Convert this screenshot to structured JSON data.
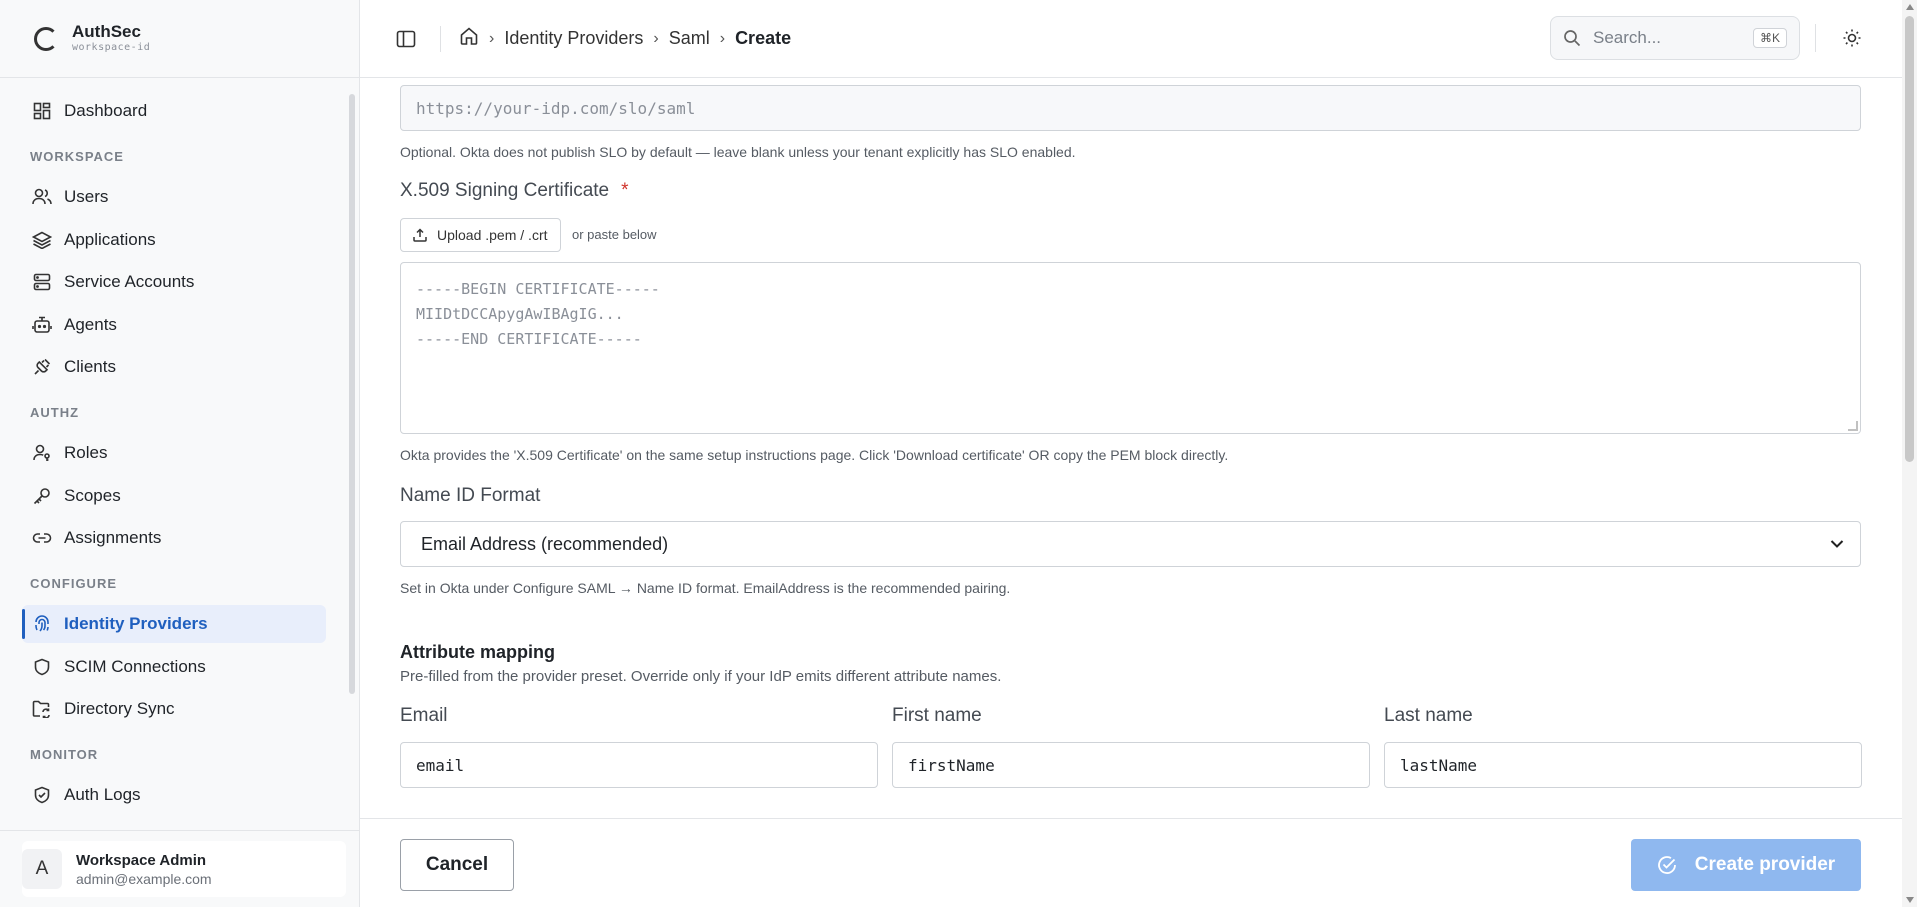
{
  "brand": {
    "name": "AuthSec",
    "workspace": "workspace-id"
  },
  "sidebar": {
    "items": [
      {
        "label": "Dashboard",
        "icon": "dashboard-icon"
      },
      {
        "section": "WORKSPACE"
      },
      {
        "label": "Users",
        "icon": "users-icon"
      },
      {
        "label": "Applications",
        "icon": "layers-icon"
      },
      {
        "label": "Service Accounts",
        "icon": "server-icon"
      },
      {
        "label": "Agents",
        "icon": "bot-icon"
      },
      {
        "label": "Clients",
        "icon": "plug-icon"
      },
      {
        "section": "AUTHZ"
      },
      {
        "label": "Roles",
        "icon": "user-key-icon"
      },
      {
        "label": "Scopes",
        "icon": "key-icon"
      },
      {
        "label": "Assignments",
        "icon": "link-icon"
      },
      {
        "section": "CONFIGURE"
      },
      {
        "label": "Identity Providers",
        "icon": "fingerprint-icon",
        "active": true
      },
      {
        "label": "SCIM Connections",
        "icon": "shield-icon"
      },
      {
        "label": "Directory Sync",
        "icon": "folder-sync-icon"
      },
      {
        "section": "MONITOR"
      },
      {
        "label": "Auth Logs",
        "icon": "shield-check-icon"
      }
    ]
  },
  "user": {
    "initial": "A",
    "name": "Workspace Admin",
    "email": "admin@example.com"
  },
  "header": {
    "breadcrumb": [
      "Identity Providers",
      "Saml",
      "Create"
    ],
    "search_placeholder": "Search...",
    "search_shortcut": "⌘K"
  },
  "form": {
    "slo_url": {
      "placeholder": "https://your-idp.com/slo/saml",
      "hint": "Optional. Okta does not publish SLO by default — leave blank unless your tenant explicitly has SLO enabled."
    },
    "certificate": {
      "label": "X.509 Signing Certificate",
      "required_mark": "*",
      "upload_label": "Upload .pem / .crt",
      "upload_note": "or paste below",
      "placeholder_lines": [
        "-----BEGIN CERTIFICATE-----",
        "MIIDtDCCApygAwIBAgIG...",
        "-----END CERTIFICATE-----"
      ],
      "hint": "Okta provides the 'X.509 Certificate' on the same setup instructions page. Click 'Download certificate' OR copy the PEM block directly."
    },
    "name_id": {
      "label": "Name ID Format",
      "selected": "Email Address (recommended)",
      "hint": "Set in Okta under Configure SAML → Name ID format. EmailAddress is the recommended pairing."
    },
    "attribute_mapping": {
      "title": "Attribute mapping",
      "subtitle": "Pre-filled from the provider preset. Override only if your IdP emits different attribute names.",
      "fields": [
        {
          "label": "Email",
          "value": "email"
        },
        {
          "label": "First name",
          "value": "firstName"
        },
        {
          "label": "Last name",
          "value": "lastName"
        }
      ]
    }
  },
  "footer": {
    "cancel_label": "Cancel",
    "create_label": "Create provider"
  },
  "colors": {
    "accent": "#1f5fbf",
    "active_bg": "#e8eefb",
    "create_button": "#8fb8ef",
    "required": "#d0342c"
  }
}
